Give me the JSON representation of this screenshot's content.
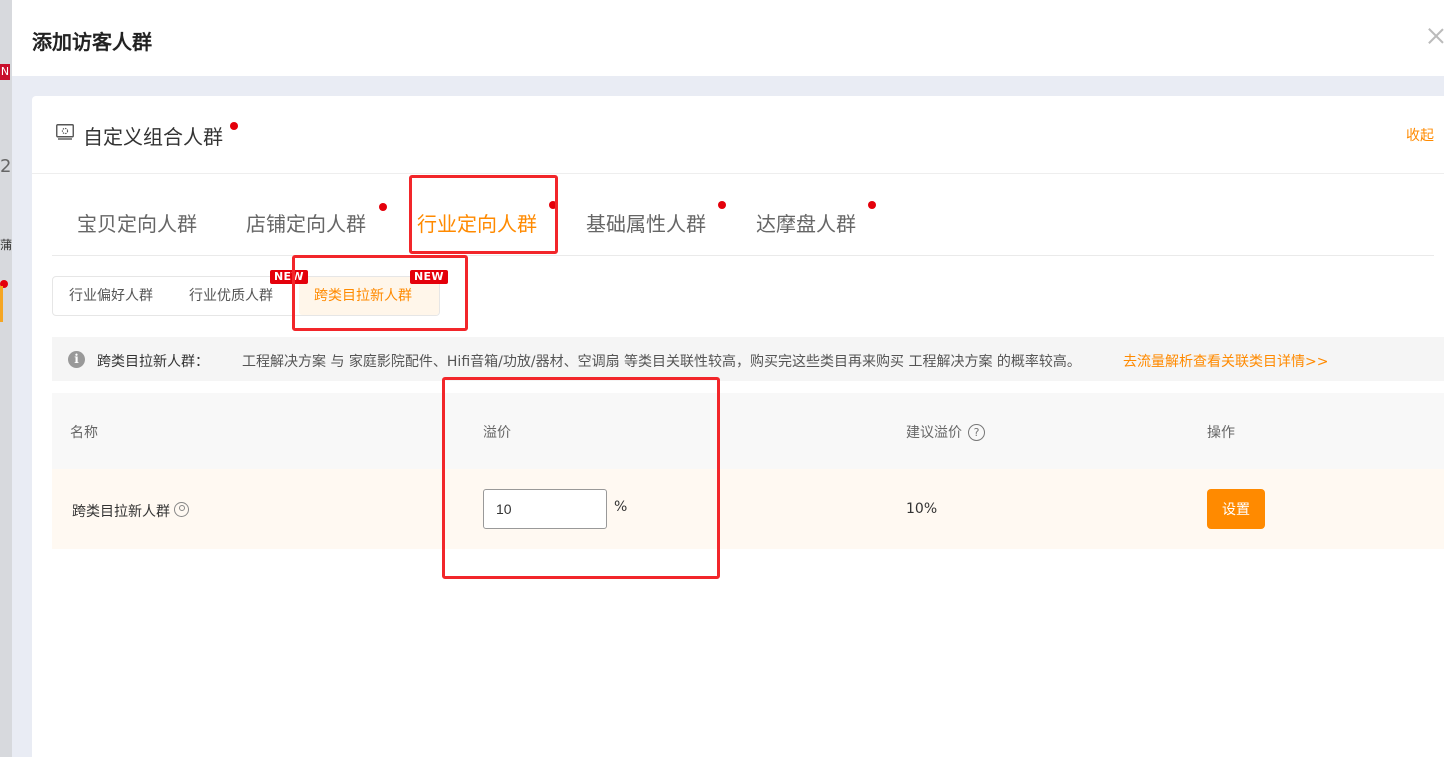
{
  "background": {
    "badge": "N",
    "digit": "2",
    "char": "蒲"
  },
  "drawer": {
    "title": "添加访客人群"
  },
  "card": {
    "title": "自定义组合人群",
    "collapse_label": "收起"
  },
  "tabs": [
    {
      "label": "宝贝定向人群",
      "active": false,
      "dot": false
    },
    {
      "label": "店铺定向人群",
      "active": false,
      "dot": true
    },
    {
      "label": "行业定向人群",
      "active": true,
      "dot": true
    },
    {
      "label": "基础属性人群",
      "active": false,
      "dot": true
    },
    {
      "label": "达摩盘人群",
      "active": false,
      "dot": true
    }
  ],
  "subtabs": [
    {
      "label": "行业偏好人群",
      "badge": ""
    },
    {
      "label": "行业优质人群",
      "badge": "NEW"
    },
    {
      "label": "跨类目拉新人群",
      "badge": "NEW"
    }
  ],
  "info": {
    "icon": "i",
    "label": "跨类目拉新人群：",
    "text": "工程解决方案 与 家庭影院配件、Hifi音箱/功放/器材、空调扇 等类目关联性较高，购买完这些类目再来购买 工程解决方案 的概率较高。",
    "link": "去流量解析查看关联类目详情>>"
  },
  "table": {
    "headers": {
      "name": "名称",
      "premium": "溢价",
      "suggested": "建议溢价",
      "action": "操作"
    },
    "rows": [
      {
        "name": "跨类目拉新人群",
        "premium_value": "10",
        "unit": "%",
        "suggested": "10%",
        "action_label": "设置"
      }
    ]
  },
  "colors": {
    "accent": "#ff8a00",
    "highlight": "#f2262a",
    "dot": "#e4000b"
  }
}
